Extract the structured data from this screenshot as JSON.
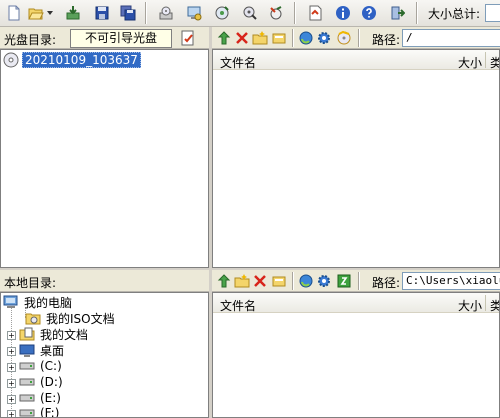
{
  "toolbar": {
    "size_total_label": "大小总计:",
    "buttons": [
      "new-file",
      "open",
      "dropdown",
      "extract",
      "save",
      "save-as",
      "burn",
      "properties",
      "compress",
      "find",
      "wrench",
      "mount",
      "info",
      "help",
      "exit"
    ]
  },
  "cd_panel": {
    "label": "光盘目录:",
    "boot_status": "不可引导光盘",
    "tree_root": "20210109_103637",
    "path_label": "路径:",
    "path_value": "/",
    "columns": [
      "文件名",
      "大小",
      "类"
    ]
  },
  "local_panel": {
    "label": "本地目录:",
    "path_label": "路径:",
    "path_value": "C:\\Users\\xiaoluo\\",
    "columns": [
      "文件名",
      "大小",
      "类"
    ],
    "tree": [
      {
        "label": "我的电脑"
      },
      {
        "label": "我的ISO文档"
      },
      {
        "label": "我的文档"
      },
      {
        "label": "桌面"
      },
      {
        "label": "(C:)"
      },
      {
        "label": "(D:)"
      },
      {
        "label": "(E:)"
      },
      {
        "label": "(F:)"
      }
    ]
  },
  "colors": {
    "selection": "#316ac5",
    "chrome": "#d4d0c8",
    "header": "#ece9d8"
  }
}
